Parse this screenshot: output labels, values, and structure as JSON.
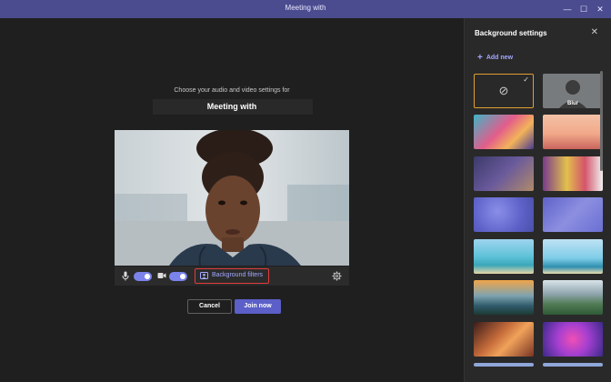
{
  "window": {
    "title": "Meeting with",
    "minimize_glyph": "—",
    "maximize_glyph": "☐",
    "close_glyph": "✕"
  },
  "prejoin": {
    "prompt": "Choose your audio and video settings for",
    "meeting_title": "Meeting with",
    "mic_on": true,
    "camera_on": true,
    "background_filters_label": "Background filters",
    "cancel_label": "Cancel",
    "join_label": "Join now"
  },
  "sidebar": {
    "title": "Background settings",
    "close_glyph": "✕",
    "add_new_label": "Add new",
    "add_new_glyph": "+",
    "none_glyph": "⊘",
    "checkmark_glyph": "✓",
    "blur_label": "Blur",
    "tiles": [
      "none",
      "blur",
      "abstract-waves",
      "pastel-room",
      "living-room",
      "colorful-shelves",
      "purple-pattern",
      "purple-photo-wall",
      "tropical-beach",
      "sunny-beach",
      "mountain-lake-sunset",
      "mountain-valley",
      "desert-canyon",
      "pink-nebula",
      "partial-tile",
      "partial-tile"
    ],
    "selected": "none"
  },
  "colors": {
    "titlebar": "#4b4b8f",
    "accent": "#5b5fc7",
    "highlight_border": "#e23c3c",
    "selected_tile_border": "#e0a030"
  }
}
